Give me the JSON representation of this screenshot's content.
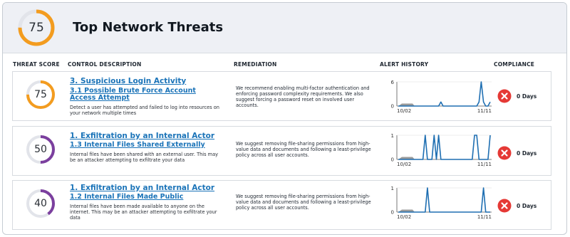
{
  "header": {
    "score": "75",
    "title": "Top Network Threats",
    "accent": "#f39c1f"
  },
  "columns": {
    "threat_score": "THREAT SCORE",
    "control_description": "CONTROL DESCRIPTION",
    "remediation": "REMEDIATION",
    "alert_history": "ALERT HISTORY",
    "compliance": "COMPLIANCE"
  },
  "rows": [
    {
      "score": "75",
      "score_fraction": 0.75,
      "ring_color": "#f39c1f",
      "title": "3. Suspicious Login Activity",
      "subtitle": "3.1 Possible Brute Force Account Access Attempt",
      "description": "Detect a user has attempted and failed to log into resources on your network multiple times",
      "remediation": "We recommend enabling multi-factor authentication and enforcing password complexity requirements. We also suggest forcing a password reset on involved user accounts.",
      "alert_history": {
        "y_max": "6",
        "y_min": "0",
        "x_start": "10/02",
        "x_end": "11/11",
        "values": [
          0,
          0,
          0,
          0,
          0,
          0,
          0,
          0,
          0,
          0,
          0,
          0,
          0,
          0,
          0,
          0,
          0,
          0,
          0,
          1,
          0,
          0,
          0,
          0,
          0,
          0,
          0,
          0,
          0,
          0,
          0,
          0,
          0,
          0,
          0,
          0,
          1,
          6,
          1,
          0,
          0,
          1
        ]
      },
      "compliance_icon": "x-circle-icon",
      "compliance": "0 Days"
    },
    {
      "score": "50",
      "score_fraction": 0.5,
      "ring_color": "#7b3f9e",
      "title": "1. Exfiltration by an Internal Actor",
      "subtitle": "1.3 Internal Files Shared Externally",
      "description": "Internal files have been shared with an external user. This may be an attacker attempting to exfiltrate your data",
      "remediation": "We suggest removing file-sharing permissions from high-value data and documents and following a least-privilege policy across all user accounts.",
      "alert_history": {
        "y_max": "1",
        "y_min": "0",
        "x_start": "10/02",
        "x_end": "11/11",
        "values": [
          0,
          0,
          0,
          0,
          0,
          0,
          0,
          0,
          0,
          0,
          0,
          0,
          1,
          0,
          0,
          0,
          1,
          0,
          1,
          0,
          0,
          0,
          0,
          0,
          0,
          0,
          0,
          0,
          0,
          0,
          0,
          0,
          0,
          0,
          1,
          1,
          0,
          0,
          0,
          0,
          0,
          1
        ]
      },
      "compliance_icon": "x-circle-icon",
      "compliance": "0 Days"
    },
    {
      "score": "40",
      "score_fraction": 0.4,
      "ring_color": "#7b3f9e",
      "title": "1. Exfiltration by an Internal Actor",
      "subtitle": "1.2 Internal Files Made Public",
      "description": "Internal files have been made available to anyone on the internet. This may be an attacker attempting to exfiltrate your data",
      "remediation": "We suggest removing file-sharing permissions from high-value data and documents and following a least-privilege policy across all user accounts.",
      "alert_history": {
        "y_max": "1",
        "y_min": "0",
        "x_start": "10/02",
        "x_end": "11/11",
        "values": [
          0,
          0,
          0,
          0,
          0,
          0,
          0,
          0,
          0,
          0,
          0,
          0,
          0,
          1,
          0,
          0,
          0,
          0,
          0,
          0,
          0,
          0,
          0,
          0,
          0,
          0,
          0,
          0,
          0,
          0,
          0,
          0,
          0,
          0,
          0,
          0,
          0,
          0,
          1,
          0,
          0,
          0
        ]
      },
      "compliance_icon": "x-circle-icon",
      "compliance": "0 Days"
    }
  ]
}
